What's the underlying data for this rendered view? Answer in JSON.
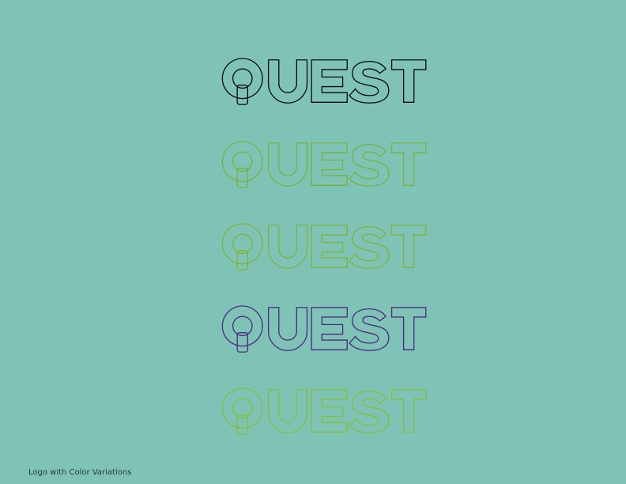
{
  "logos": [
    {
      "wordmark": "QUEST",
      "top_color": "#7fc3b7",
      "bottom_color": "#0a0a0a",
      "stroke": "#0a0a0a",
      "variant": "outline-black"
    },
    {
      "wordmark": "QUEST",
      "top_color": "#4b2a7a",
      "bottom_color": "#74b535",
      "stroke": "#74b535",
      "variant": "purple-green"
    },
    {
      "wordmark": "QUEST",
      "top_color": "#7db52f",
      "bottom_color": "#8a5a5e",
      "stroke": "#7db52f",
      "variant": "green-mauve"
    },
    {
      "wordmark": "QUEST",
      "top_color": "#7a4c6a",
      "bottom_color": "#4b2a80",
      "stroke": "#4b2a80",
      "variant": "mauve-purple"
    },
    {
      "wordmark": "QUEST",
      "top_color": "#0d6a5c",
      "bottom_color": "#82c132",
      "stroke": "#82c132",
      "variant": "teal-green"
    }
  ],
  "caption": "Logo with Color Variations"
}
